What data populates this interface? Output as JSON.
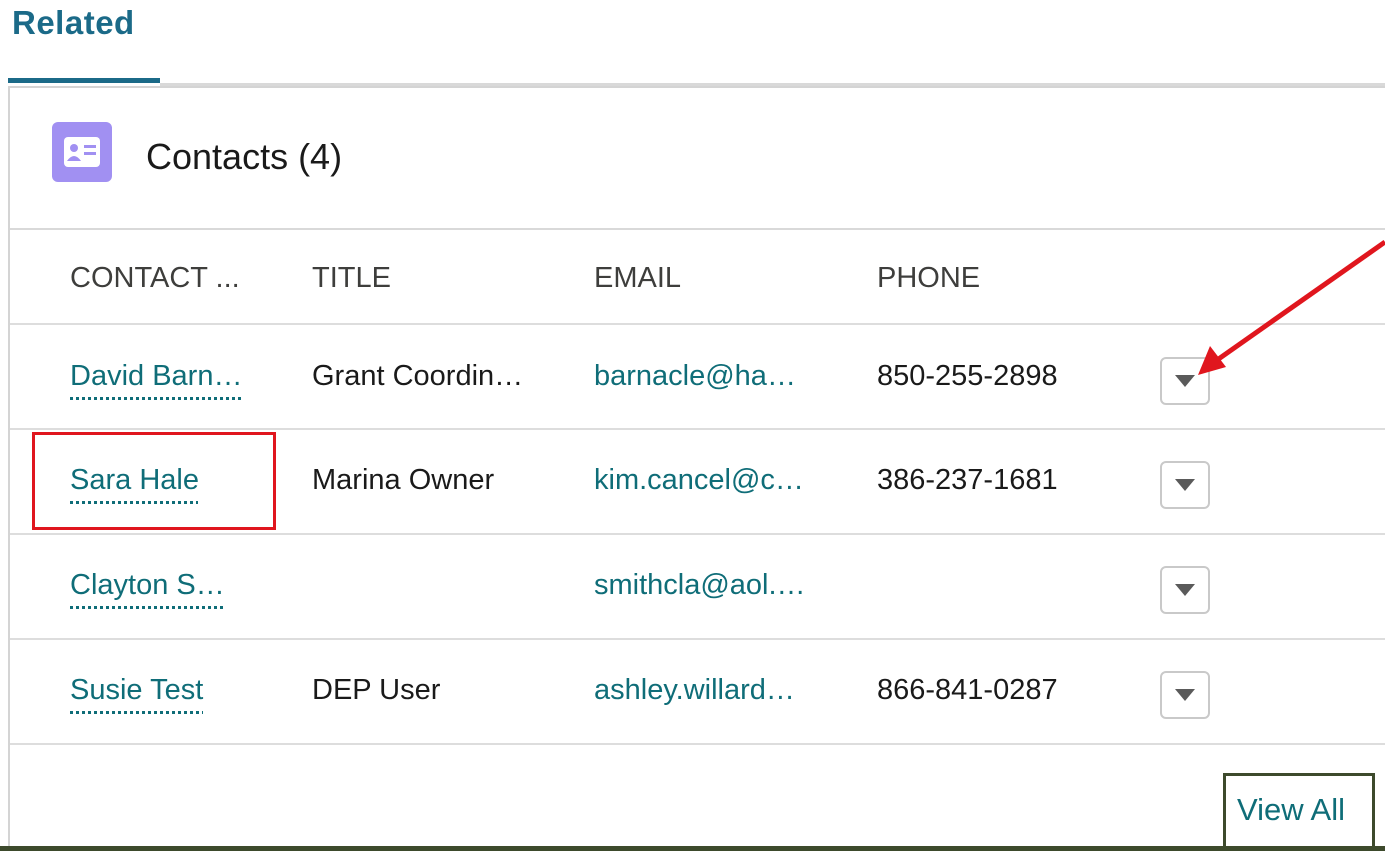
{
  "section": {
    "tab_label": "Related"
  },
  "card": {
    "title": "Contacts (4)",
    "icon": "contact-card-icon",
    "icon_color": "#a190f2"
  },
  "table": {
    "columns": [
      "CONTACT ...",
      "TITLE",
      "EMAIL",
      "PHONE"
    ],
    "rows": [
      {
        "name": "David Barn…",
        "title": "Grant Coordin…",
        "email": "barnacle@ha…",
        "phone": "850-255-2898"
      },
      {
        "name": "Sara Hale",
        "title": "Marina Owner",
        "email": "kim.cancel@c…",
        "phone": "386-237-1681"
      },
      {
        "name": "Clayton S…",
        "title": "",
        "email": "smithcla@aol.…",
        "phone": ""
      },
      {
        "name": "Susie Test",
        "title": "DEP User",
        "email": "ashley.willard…",
        "phone": "866-841-0287"
      }
    ]
  },
  "footer": {
    "view_all_label": "View All"
  },
  "colors": {
    "accent": "#1b6a88",
    "link": "#0f6d78",
    "annotation_red": "#e0161e",
    "annotation_green": "#3d4a2c"
  }
}
